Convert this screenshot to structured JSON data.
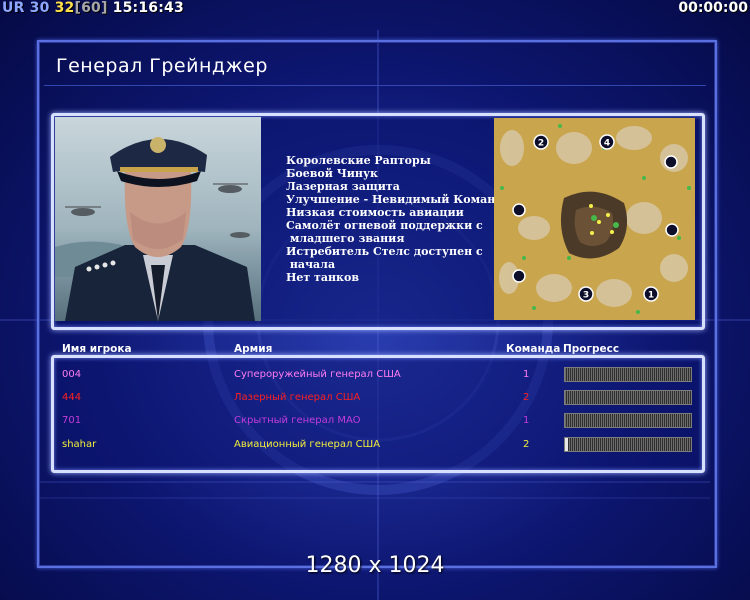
{
  "hud": {
    "ur_label": "UR",
    "ur_value": "30",
    "fps": "32",
    "fps_cap": "[60]",
    "clock": "15:16:43",
    "timer": "00:00:00"
  },
  "title": "Генерал Грейнджер",
  "features": [
    "Королевские Рапторы",
    "Боевой Чинук",
    "Лазерная защита",
    "Улучшение - Невидимый Команч",
    "Низкая стоимость авиации",
    "Самолёт огневой поддержки с",
    " младшего звания",
    "Истребитель Стелс доступен с",
    " начала",
    "Нет танков"
  ],
  "map": {
    "start_positions": [
      "1",
      "2",
      "3",
      "4"
    ]
  },
  "table": {
    "headers": {
      "player": "Имя игрока",
      "army": "Армия",
      "team": "Команда",
      "progress": "Прогресс"
    },
    "rows": [
      {
        "name": "004",
        "army": "Супероружейный генерал США",
        "team": "1",
        "color": "#ff7cf0",
        "progress": 0.0
      },
      {
        "name": "444",
        "army": "Лазерный генерал США",
        "team": "2",
        "color": "#ff2020",
        "progress": 0.0
      },
      {
        "name": "701",
        "army": "Скрытный генерал MAO",
        "team": "1",
        "color": "#c43cdc",
        "progress": 0.0
      },
      {
        "name": "shahar",
        "army": "Авиационный генерал США",
        "team": "2",
        "color": "#f2ee3a",
        "progress": 0.02
      }
    ]
  },
  "resolution": "1280 x 1024"
}
